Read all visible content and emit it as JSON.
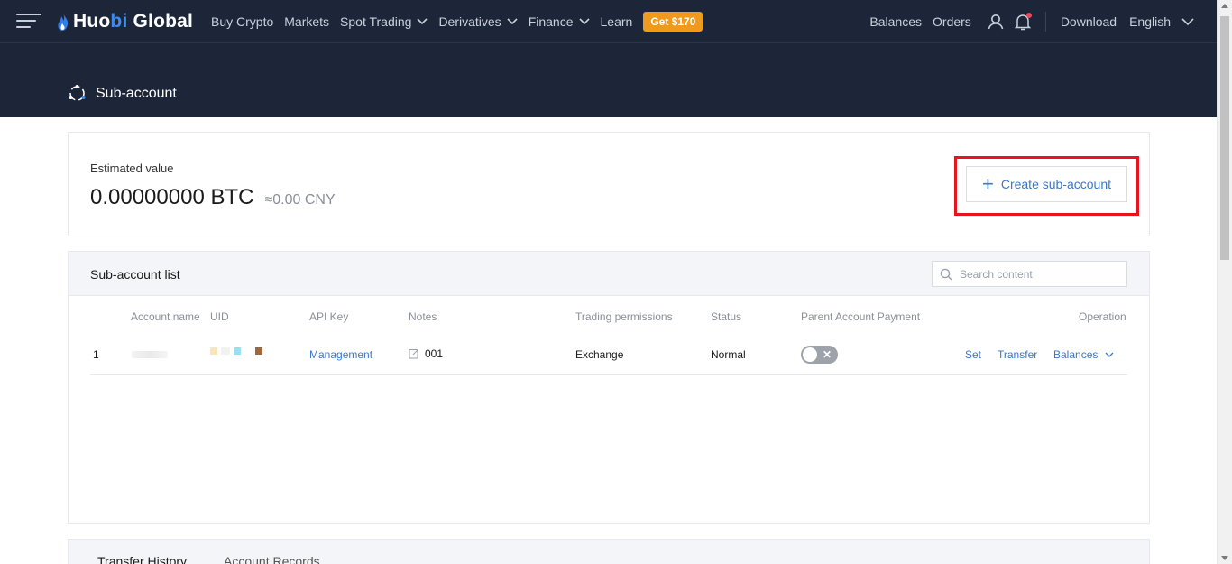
{
  "nav": {
    "logo_part1": "Huo",
    "logo_part2": "bi",
    "logo_part3": " Global",
    "items": [
      "Buy Crypto",
      "Markets",
      "Spot Trading",
      "Derivatives",
      "Finance",
      "Learn"
    ],
    "promo": "Get $170",
    "right": {
      "balances": "Balances",
      "orders": "Orders",
      "download": "Download",
      "language": "English"
    }
  },
  "page": {
    "title": "Sub-account"
  },
  "estimate": {
    "label": "Estimated value",
    "btc": "0.00000000 BTC",
    "cny": "≈0.00 CNY",
    "create_button": "Create sub-account"
  },
  "list": {
    "title": "Sub-account list",
    "search_placeholder": "Search content",
    "headers": {
      "account_name": "Account name",
      "uid": "UID",
      "api_key": "API Key",
      "notes": "Notes",
      "trading_permissions": "Trading permissions",
      "status": "Status",
      "parent_payment": "Parent Account Payment",
      "operation": "Operation"
    },
    "rows": [
      {
        "index": "1",
        "api_key": "Management",
        "notes": "001",
        "trading_permissions": "Exchange",
        "status": "Normal",
        "parent_payment_enabled": false,
        "ops": {
          "set": "Set",
          "transfer": "Transfer",
          "balances": "Balances"
        }
      }
    ]
  },
  "tabs": {
    "transfer_history": "Transfer History",
    "account_records": "Account Records"
  },
  "colors": {
    "nav_bg": "#1d2639",
    "accent": "#3a78c9",
    "promo": "#ef9a1c",
    "highlight": "#e8141d"
  }
}
